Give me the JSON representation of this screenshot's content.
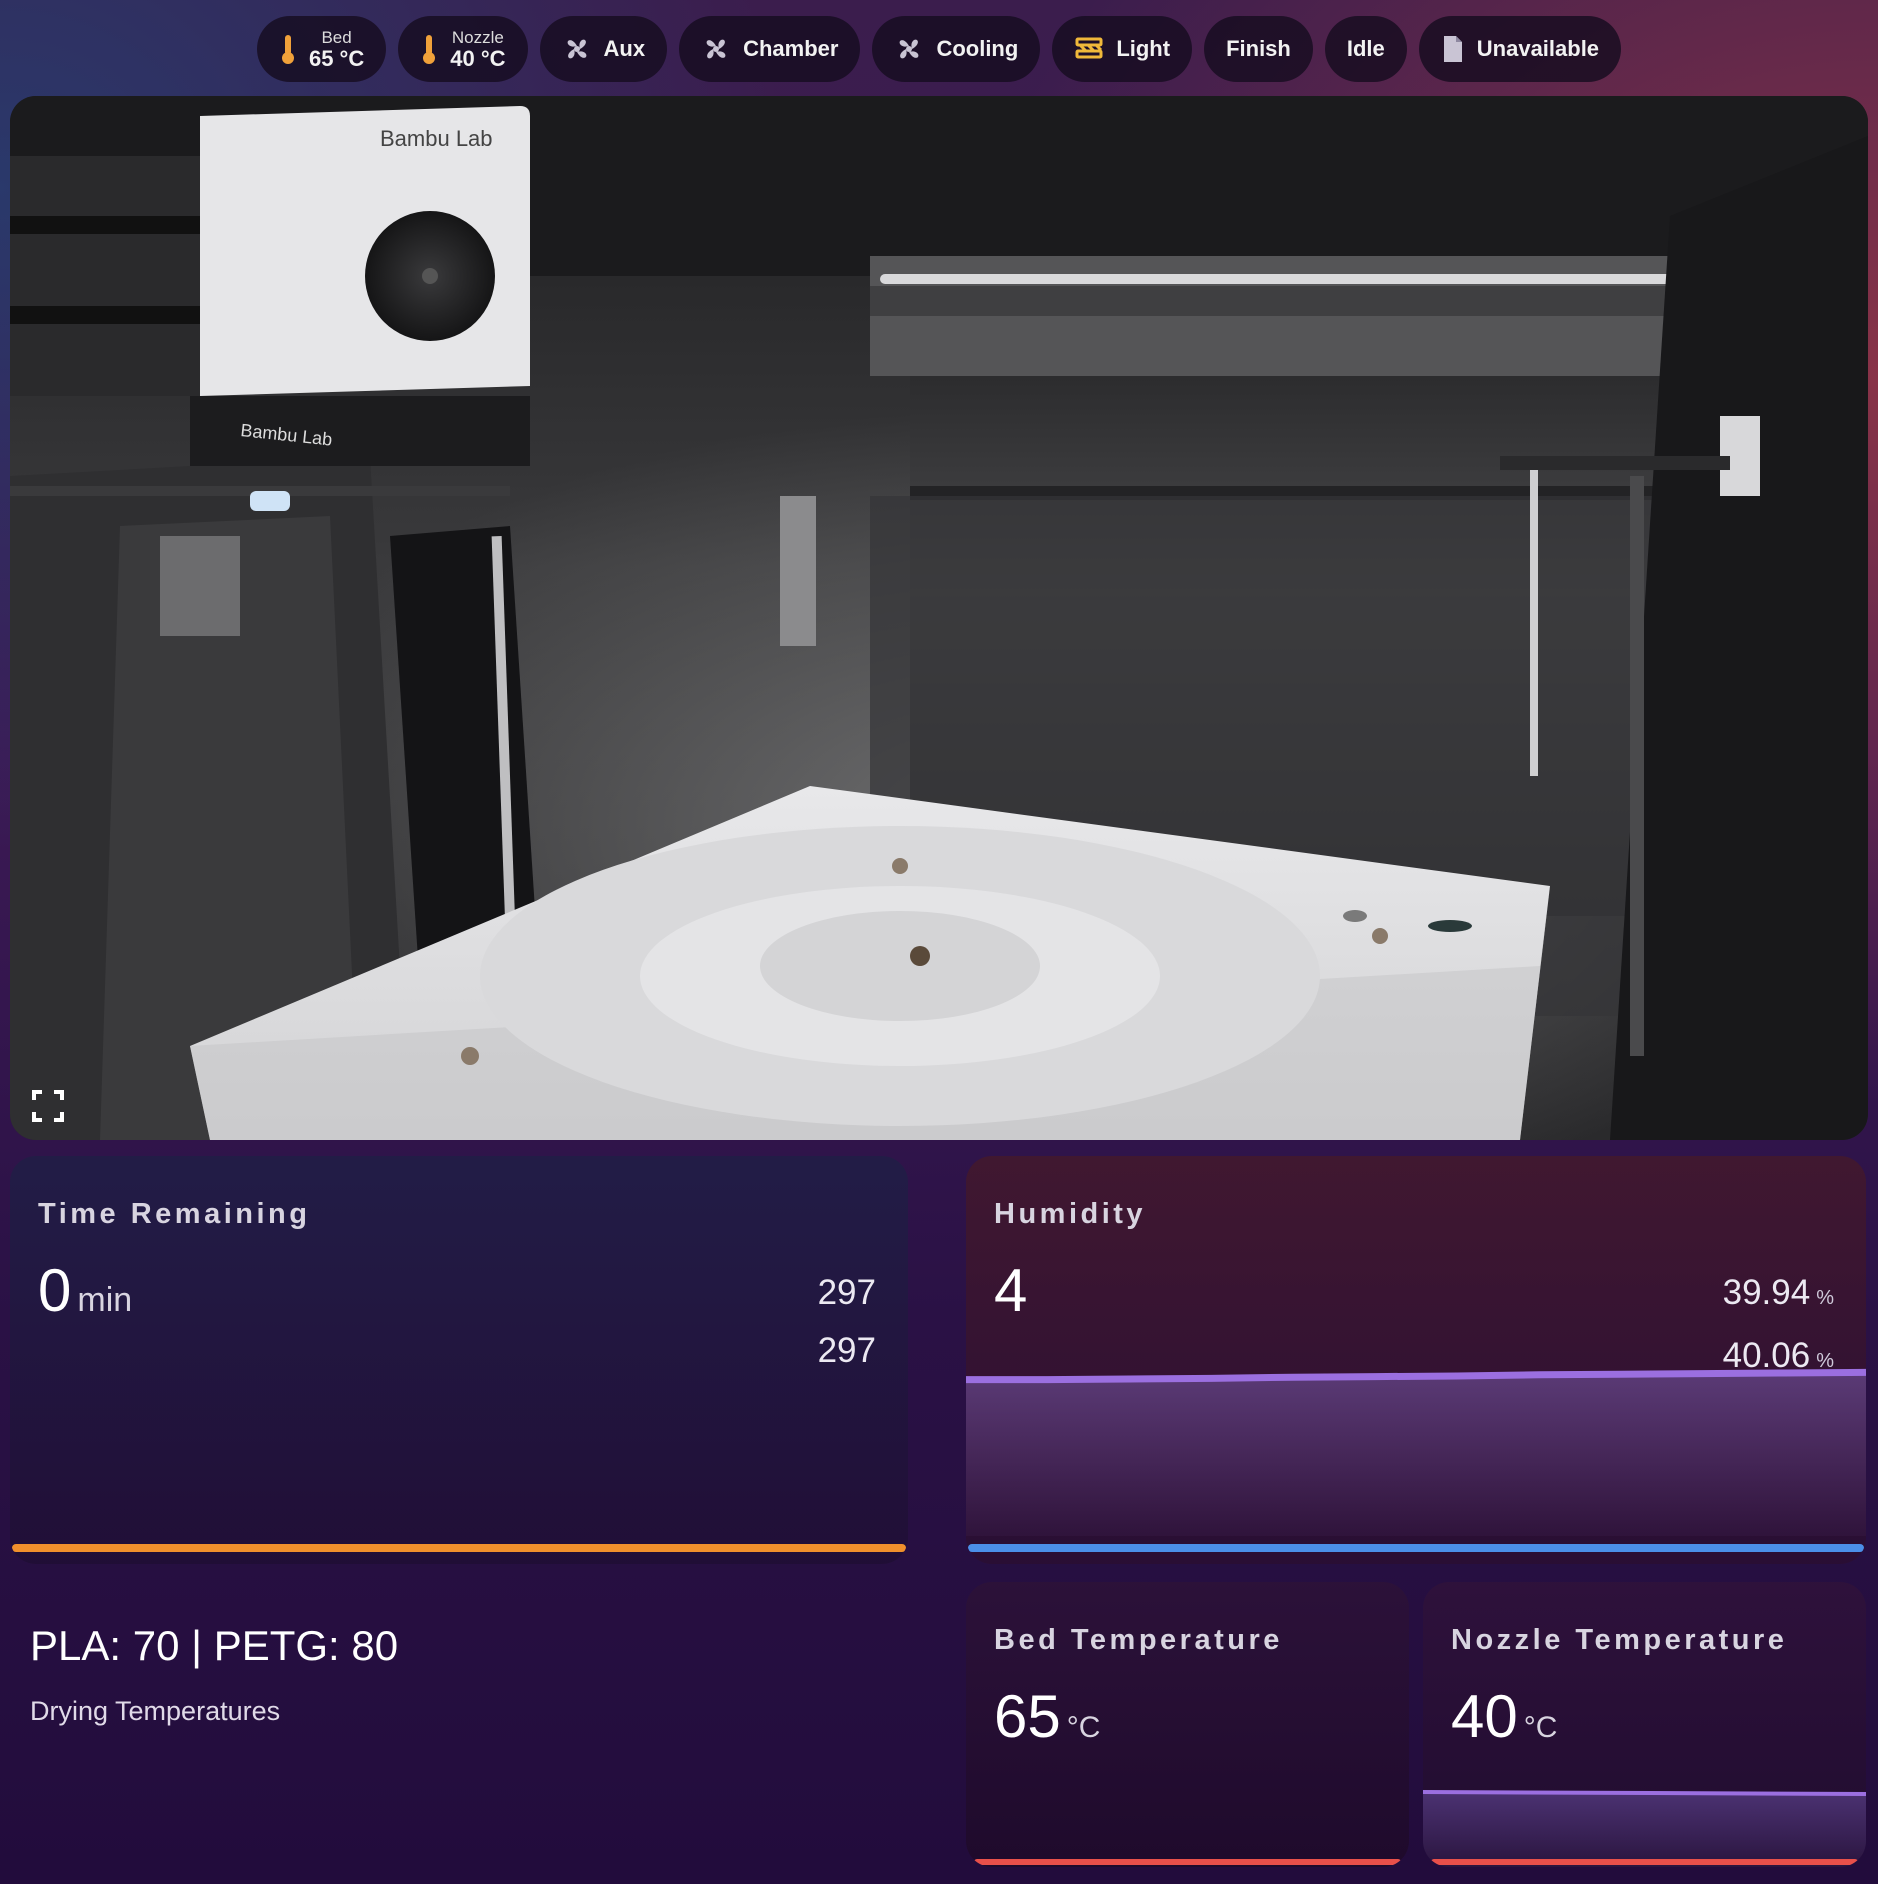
{
  "chips": {
    "bed": {
      "label": "Bed",
      "value": "65 °C"
    },
    "nozzle": {
      "label": "Nozzle",
      "value": "40 °C"
    },
    "aux": {
      "label": "Aux"
    },
    "chamber": {
      "label": "Chamber"
    },
    "cooling": {
      "label": "Cooling"
    },
    "light": {
      "label": "Light"
    },
    "finish": {
      "label": "Finish"
    },
    "idle": {
      "label": "Idle"
    },
    "unavailable": {
      "label": "Unavailable"
    }
  },
  "camera": {
    "brand_top": "Bambu Lab",
    "brand_bottom": "Bambu Lab"
  },
  "time_remaining": {
    "title": "Time Remaining",
    "value": "0",
    "unit": "min",
    "sub1": "297",
    "sub2": "297",
    "bar_color": "#f0902c"
  },
  "humidity": {
    "title": "Humidity",
    "value": "4",
    "sub1": "39.94",
    "sub2": "40.06",
    "pct": "%",
    "line_color": "#9b6fe0",
    "bar_color": "#4b8fe8",
    "history": [
      39.94,
      39.94,
      39.95,
      39.96,
      39.98,
      39.99,
      40.0,
      40.02,
      40.03,
      40.04,
      40.05,
      40.06
    ]
  },
  "drying": {
    "headline": "PLA: 70 | PETG: 80",
    "caption": "Drying Temperatures"
  },
  "bed_temperature": {
    "title": "Bed Temperature",
    "value": "65",
    "unit": "°C",
    "bar_color": "#e8504a"
  },
  "nozzle_temperature": {
    "title": "Nozzle Temperature",
    "value": "40",
    "unit": "°C",
    "line_color": "#9b6fe0",
    "bar_color": "#e8504a"
  },
  "colors": {
    "thermometer": "#f0a13a",
    "fan_icon": "#c9c4d4",
    "light_icon": "#f0b83a",
    "chip_bg": "#160c20"
  }
}
